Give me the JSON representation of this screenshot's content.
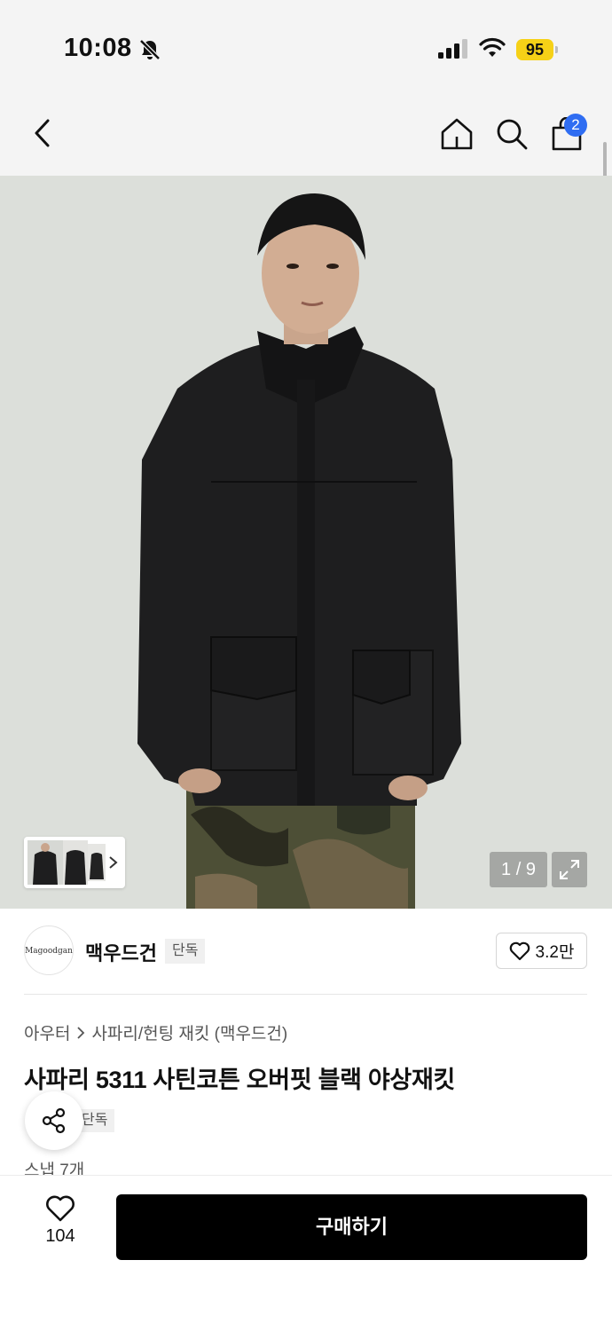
{
  "status_bar": {
    "time": "10:08",
    "battery": "95"
  },
  "header": {
    "cart_count": "2"
  },
  "gallery": {
    "counter": "1 / 9"
  },
  "brand": {
    "logo_text": "Magoodgan",
    "name": "맥우드건",
    "exclusive_tag": "단독",
    "likes": "3.2만"
  },
  "product": {
    "breadcrumb": [
      "아우터",
      "사파리/헌팅 재킷 (맥우드건)"
    ],
    "title": "사파리 5311 사틴코튼 오버핏 블랙 야상재킷",
    "tag": "단독",
    "snap": "스냅 7개"
  },
  "bottom": {
    "wish_count": "104",
    "buy_label": "구매하기"
  },
  "colors": {
    "accent_blue": "#2f6df2",
    "battery_yellow": "#f6d117",
    "buy_black": "#000000"
  }
}
